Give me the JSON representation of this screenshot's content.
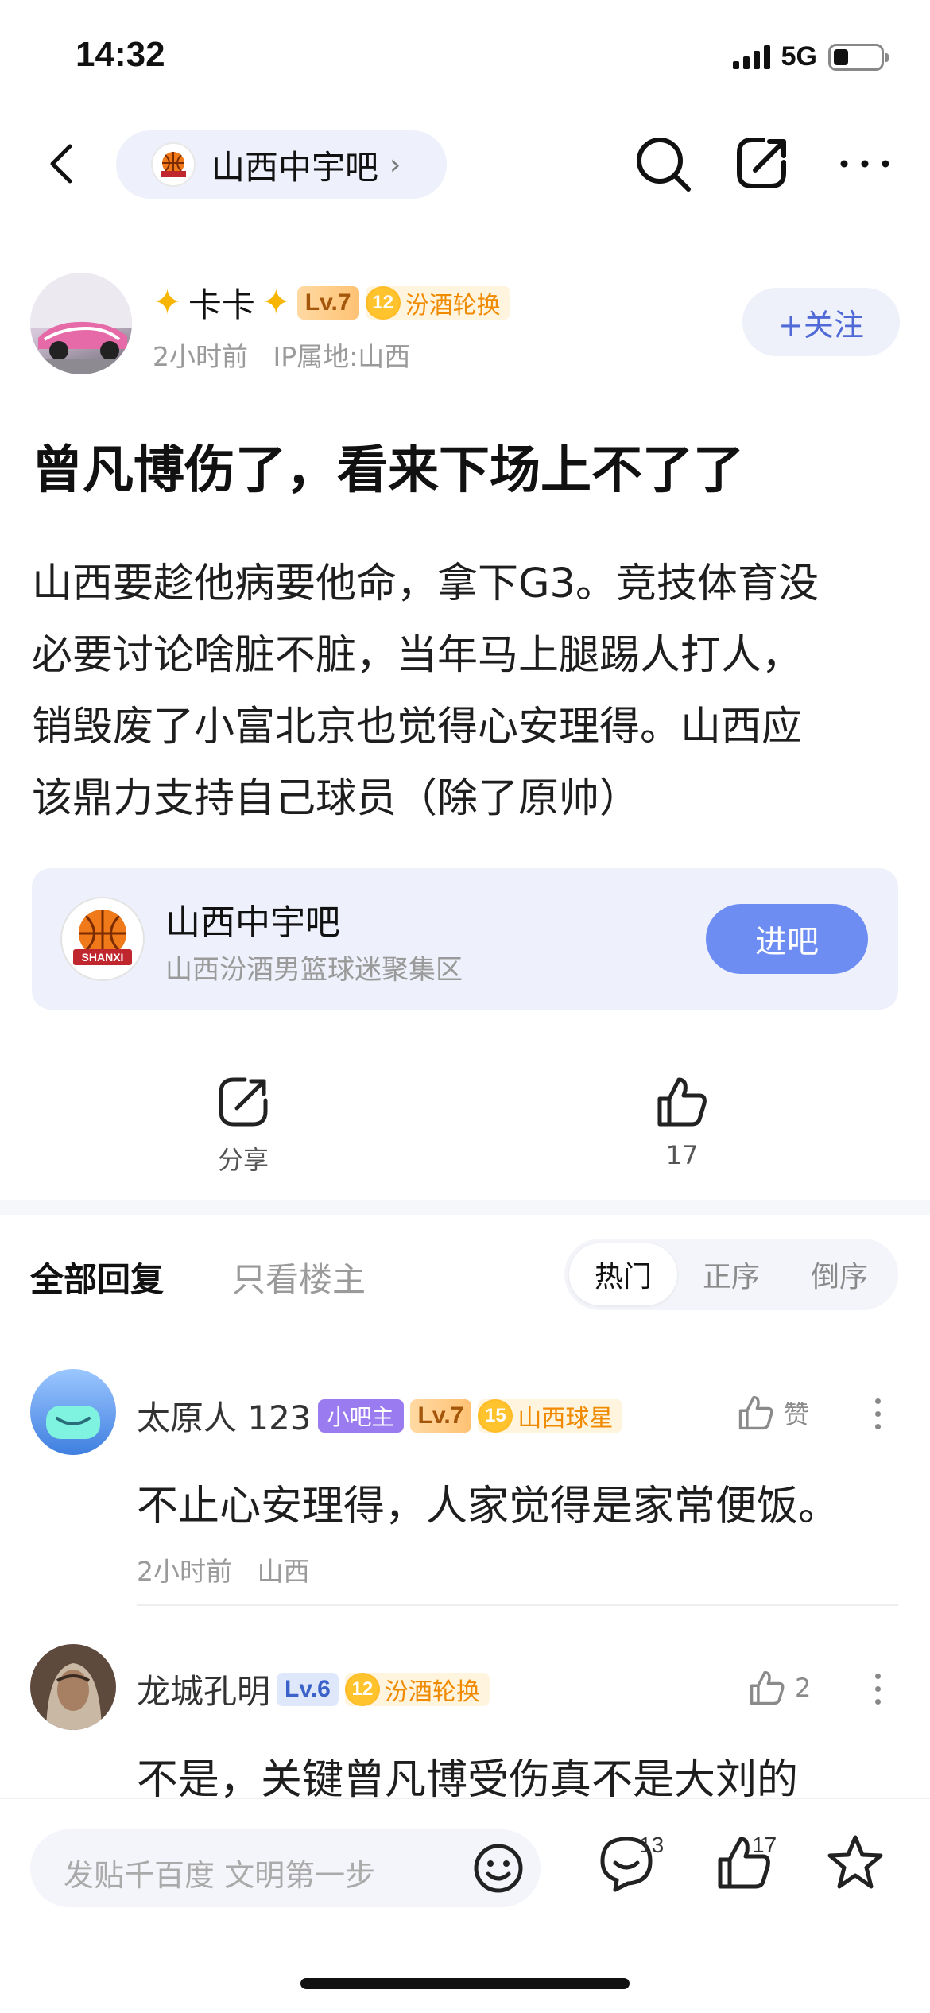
{
  "status_bar": {
    "time": "14:32",
    "network": "5G"
  },
  "nav": {
    "forum_name": "山西中宇吧"
  },
  "post": {
    "author": {
      "name": "卡卡",
      "level": "Lv.7",
      "title_level": "12",
      "title": "汾酒轮换"
    },
    "time": "2小时前",
    "ip": "IP属地:山西",
    "follow_label": "+关注",
    "title": "曾凡博伤了，看来下场上不了了",
    "body_lines": [
      "山西要趁他病要他命，拿下G3。竞技体育没",
      "必要讨论啥脏不脏，当年马上腿踢人打人，",
      "销毁废了小富北京也觉得心安理得。山西应",
      "该鼎力支持自己球员（除了原帅）"
    ]
  },
  "forum_card": {
    "name": "山西中宇吧",
    "desc": "山西汾酒男篮球迷聚集区",
    "enter_label": "进吧",
    "logo_text": "SHANXI"
  },
  "actions": {
    "share_label": "分享",
    "like_count": "17"
  },
  "replies": {
    "tab_all": "全部回复",
    "tab_host": "只看楼主",
    "sort": [
      "热门",
      "正序",
      "倒序"
    ],
    "comments": [
      {
        "name": "太原人 123",
        "mod_badge": "小吧主",
        "level": "Lv.7",
        "title_level": "15",
        "title": "山西球星",
        "like_label": "赞",
        "text": "不止心安理得，人家觉得是家常便饭。",
        "time": "2小时前",
        "location": "山西"
      },
      {
        "name": "龙城孔明",
        "level": "Lv.6",
        "title_level": "12",
        "title": "汾酒轮换",
        "like_label": "2",
        "text": "不是，关键曾凡博受伤真不是大刘的"
      }
    ]
  },
  "bottom_bar": {
    "placeholder": "发贴千百度 文明第一步",
    "comment_count": "13",
    "like_count": "17"
  },
  "colors": {
    "accent": "#6e8df2",
    "follow_text": "#4f6ad6",
    "pill_bg": "#eef1fb",
    "mod_badge": "#9b7cf0",
    "title_badge": "#f08a00"
  }
}
